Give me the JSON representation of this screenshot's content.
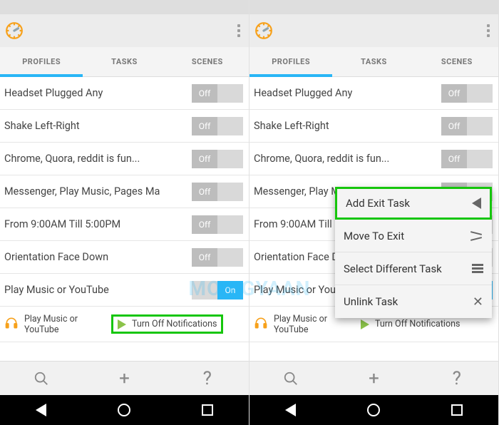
{
  "tabs": {
    "profiles": "PROFILES",
    "tasks": "TASKS",
    "scenes": "SCENES"
  },
  "toggle": {
    "on": "On",
    "off": "Off"
  },
  "profiles": [
    {
      "name": "Headset Plugged Any",
      "state": "off"
    },
    {
      "name": "Shake Left-Right",
      "state": "off"
    },
    {
      "name": "Chrome, Quora, reddit is fun...",
      "state": "off"
    },
    {
      "name": "Messenger, Play Music, Pages Ma",
      "state": "off"
    },
    {
      "name": "From  9:00AM Till  5:00PM",
      "state": "off"
    },
    {
      "name": "Orientation Face Down",
      "state": "off"
    },
    {
      "name": "Play Music or YouTube",
      "state": "on"
    }
  ],
  "sub": {
    "left_label": "Play Music or YouTube",
    "right_label": "Turn Off Notifications"
  },
  "menu": {
    "add_exit": "Add Exit Task",
    "move_exit": "Move To Exit",
    "select_diff": "Select Different Task",
    "unlink": "Unlink Task"
  },
  "watermark": "MOBIGYAAN"
}
